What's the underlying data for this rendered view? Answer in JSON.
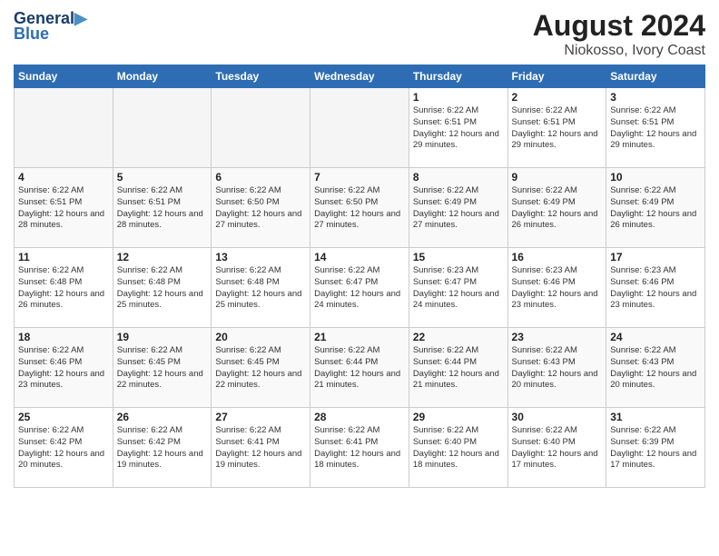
{
  "logo": {
    "line1": "General",
    "line2": "Blue"
  },
  "title": "August 2024",
  "subtitle": "Niokosso, Ivory Coast",
  "headers": [
    "Sunday",
    "Monday",
    "Tuesday",
    "Wednesday",
    "Thursday",
    "Friday",
    "Saturday"
  ],
  "weeks": [
    [
      {
        "day": "",
        "info": ""
      },
      {
        "day": "",
        "info": ""
      },
      {
        "day": "",
        "info": ""
      },
      {
        "day": "",
        "info": ""
      },
      {
        "day": "1",
        "info": "Sunrise: 6:22 AM\nSunset: 6:51 PM\nDaylight: 12 hours\nand 29 minutes."
      },
      {
        "day": "2",
        "info": "Sunrise: 6:22 AM\nSunset: 6:51 PM\nDaylight: 12 hours\nand 29 minutes."
      },
      {
        "day": "3",
        "info": "Sunrise: 6:22 AM\nSunset: 6:51 PM\nDaylight: 12 hours\nand 29 minutes."
      }
    ],
    [
      {
        "day": "4",
        "info": "Sunrise: 6:22 AM\nSunset: 6:51 PM\nDaylight: 12 hours\nand 28 minutes."
      },
      {
        "day": "5",
        "info": "Sunrise: 6:22 AM\nSunset: 6:51 PM\nDaylight: 12 hours\nand 28 minutes."
      },
      {
        "day": "6",
        "info": "Sunrise: 6:22 AM\nSunset: 6:50 PM\nDaylight: 12 hours\nand 27 minutes."
      },
      {
        "day": "7",
        "info": "Sunrise: 6:22 AM\nSunset: 6:50 PM\nDaylight: 12 hours\nand 27 minutes."
      },
      {
        "day": "8",
        "info": "Sunrise: 6:22 AM\nSunset: 6:49 PM\nDaylight: 12 hours\nand 27 minutes."
      },
      {
        "day": "9",
        "info": "Sunrise: 6:22 AM\nSunset: 6:49 PM\nDaylight: 12 hours\nand 26 minutes."
      },
      {
        "day": "10",
        "info": "Sunrise: 6:22 AM\nSunset: 6:49 PM\nDaylight: 12 hours\nand 26 minutes."
      }
    ],
    [
      {
        "day": "11",
        "info": "Sunrise: 6:22 AM\nSunset: 6:48 PM\nDaylight: 12 hours\nand 26 minutes."
      },
      {
        "day": "12",
        "info": "Sunrise: 6:22 AM\nSunset: 6:48 PM\nDaylight: 12 hours\nand 25 minutes."
      },
      {
        "day": "13",
        "info": "Sunrise: 6:22 AM\nSunset: 6:48 PM\nDaylight: 12 hours\nand 25 minutes."
      },
      {
        "day": "14",
        "info": "Sunrise: 6:22 AM\nSunset: 6:47 PM\nDaylight: 12 hours\nand 24 minutes."
      },
      {
        "day": "15",
        "info": "Sunrise: 6:23 AM\nSunset: 6:47 PM\nDaylight: 12 hours\nand 24 minutes."
      },
      {
        "day": "16",
        "info": "Sunrise: 6:23 AM\nSunset: 6:46 PM\nDaylight: 12 hours\nand 23 minutes."
      },
      {
        "day": "17",
        "info": "Sunrise: 6:23 AM\nSunset: 6:46 PM\nDaylight: 12 hours\nand 23 minutes."
      }
    ],
    [
      {
        "day": "18",
        "info": "Sunrise: 6:22 AM\nSunset: 6:46 PM\nDaylight: 12 hours\nand 23 minutes."
      },
      {
        "day": "19",
        "info": "Sunrise: 6:22 AM\nSunset: 6:45 PM\nDaylight: 12 hours\nand 22 minutes."
      },
      {
        "day": "20",
        "info": "Sunrise: 6:22 AM\nSunset: 6:45 PM\nDaylight: 12 hours\nand 22 minutes."
      },
      {
        "day": "21",
        "info": "Sunrise: 6:22 AM\nSunset: 6:44 PM\nDaylight: 12 hours\nand 21 minutes."
      },
      {
        "day": "22",
        "info": "Sunrise: 6:22 AM\nSunset: 6:44 PM\nDaylight: 12 hours\nand 21 minutes."
      },
      {
        "day": "23",
        "info": "Sunrise: 6:22 AM\nSunset: 6:43 PM\nDaylight: 12 hours\nand 20 minutes."
      },
      {
        "day": "24",
        "info": "Sunrise: 6:22 AM\nSunset: 6:43 PM\nDaylight: 12 hours\nand 20 minutes."
      }
    ],
    [
      {
        "day": "25",
        "info": "Sunrise: 6:22 AM\nSunset: 6:42 PM\nDaylight: 12 hours\nand 20 minutes."
      },
      {
        "day": "26",
        "info": "Sunrise: 6:22 AM\nSunset: 6:42 PM\nDaylight: 12 hours\nand 19 minutes."
      },
      {
        "day": "27",
        "info": "Sunrise: 6:22 AM\nSunset: 6:41 PM\nDaylight: 12 hours\nand 19 minutes."
      },
      {
        "day": "28",
        "info": "Sunrise: 6:22 AM\nSunset: 6:41 PM\nDaylight: 12 hours\nand 18 minutes."
      },
      {
        "day": "29",
        "info": "Sunrise: 6:22 AM\nSunset: 6:40 PM\nDaylight: 12 hours\nand 18 minutes."
      },
      {
        "day": "30",
        "info": "Sunrise: 6:22 AM\nSunset: 6:40 PM\nDaylight: 12 hours\nand 17 minutes."
      },
      {
        "day": "31",
        "info": "Sunrise: 6:22 AM\nSunset: 6:39 PM\nDaylight: 12 hours\nand 17 minutes."
      }
    ]
  ]
}
